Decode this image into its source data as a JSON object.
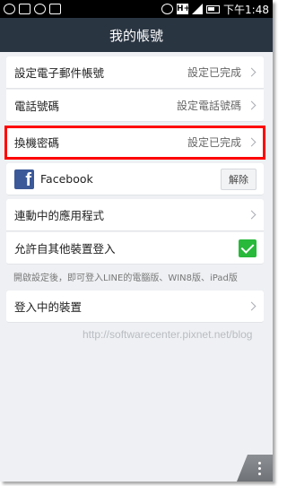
{
  "status_bar": {
    "time": "下午1:48",
    "network": "H+"
  },
  "header": {
    "title": "我的帳號"
  },
  "rows": {
    "email": {
      "label": "設定電子郵件帳號",
      "value": "設定已完成"
    },
    "phone": {
      "label": "電話號碼",
      "value": "設定電話號碼"
    },
    "password": {
      "label": "換機密碼",
      "value": "設定已完成"
    },
    "facebook": {
      "label": "Facebook",
      "button": "解除",
      "logo": "f"
    },
    "linked_apps": {
      "label": "連動中的應用程式"
    },
    "allow_login": {
      "label": "允許自其他裝置登入",
      "checked": true
    },
    "devices": {
      "label": "登入中的裝置"
    }
  },
  "note": "開啟設定後，即可登入LINE的電腦版、WIN8版、iPad版",
  "watermark": "http://softwarecenter.pixnet.net/blog",
  "colors": {
    "header_bg": "#2a3542",
    "highlight": "#ff0000",
    "facebook": "#3b5998",
    "check": "#28b83a"
  }
}
